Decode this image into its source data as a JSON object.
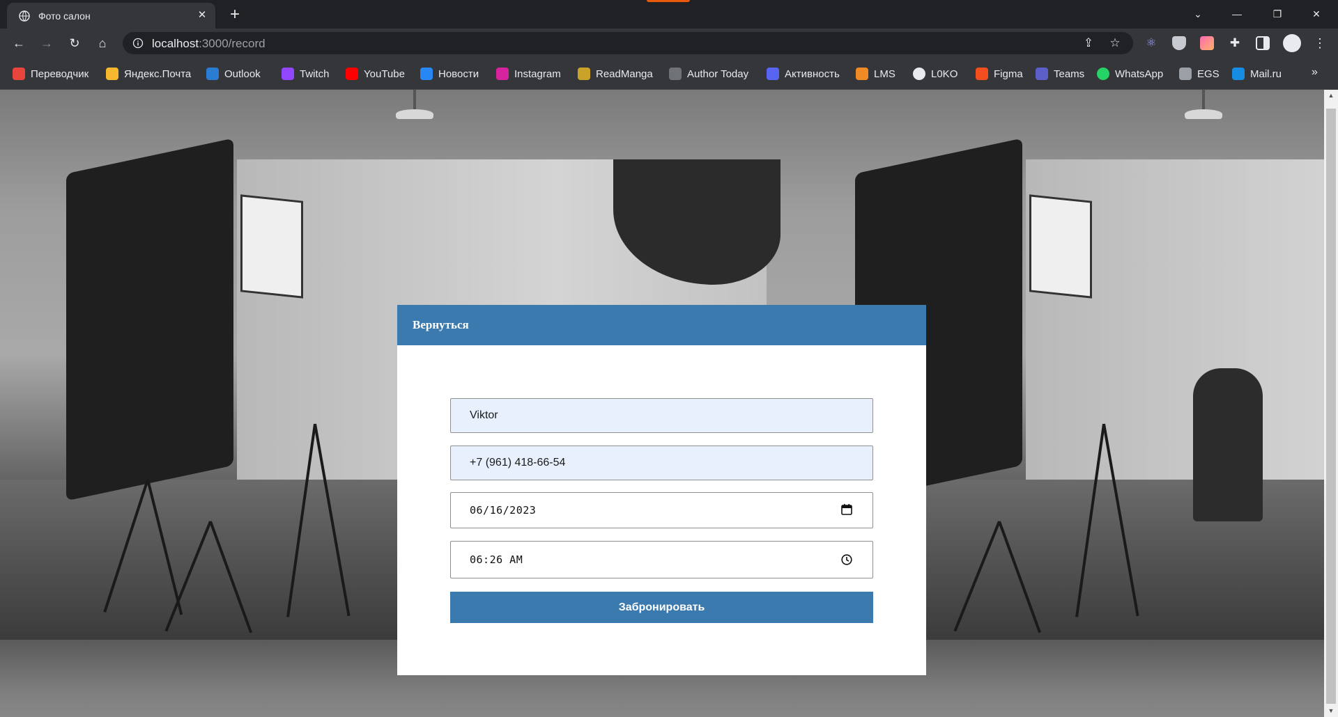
{
  "browser": {
    "tab_title": "Фото салон",
    "tab_close": "✕",
    "new_tab": "+",
    "url_host": "localhost",
    "url_path": ":3000/record",
    "window_controls": [
      "⌄",
      "—",
      "❐",
      "✕"
    ]
  },
  "bookmarks": [
    {
      "label": "Переводчик",
      "icon": "translate-icon",
      "color": "#e8453c"
    },
    {
      "label": "Яндекс.Почта",
      "icon": "mail-icon",
      "color": "#f5b82e"
    },
    {
      "label": "Outlook",
      "icon": "outlook-icon",
      "color": "#2b7cd3"
    },
    {
      "label": "Twitch",
      "icon": "twitch-icon",
      "color": "#9146ff"
    },
    {
      "label": "YouTube",
      "icon": "youtube-icon",
      "color": "#ff0000"
    },
    {
      "label": "Новости",
      "icon": "vk-icon",
      "color": "#2787f5"
    },
    {
      "label": "Instagram",
      "icon": "instagram-icon",
      "color": "#d6249f"
    },
    {
      "label": "ReadManga",
      "icon": "readmanga-icon",
      "color": "#c9a227"
    },
    {
      "label": "Author Today",
      "icon": "pen-icon",
      "color": "#6f7377"
    },
    {
      "label": "Активность",
      "icon": "discord-icon",
      "color": "#5865f2"
    },
    {
      "label": "LMS",
      "icon": "lms-icon",
      "color": "#f08a24"
    },
    {
      "label": "L0KO",
      "icon": "github-icon",
      "color": "#e8eaed"
    },
    {
      "label": "Figma",
      "icon": "figma-icon",
      "color": "#f24e1e"
    },
    {
      "label": "Teams",
      "icon": "teams-icon",
      "color": "#5b5fc7"
    },
    {
      "label": "WhatsApp",
      "icon": "whatsapp-icon",
      "color": "#25d366"
    },
    {
      "label": "EGS",
      "icon": "egs-icon",
      "color": "#9aa0a6"
    },
    {
      "label": "Mail.ru",
      "icon": "mailru-icon",
      "color": "#168de2"
    }
  ],
  "bookmarks_more": "»",
  "page": {
    "back_link": "Вернуться",
    "name_value": "Viktor",
    "phone_value": "+7 (961) 418-66-54",
    "date_value": "06/16/2023",
    "time_value": "06:26 AM",
    "submit_label": "Забронировать",
    "accent_color": "#3b7aae"
  }
}
